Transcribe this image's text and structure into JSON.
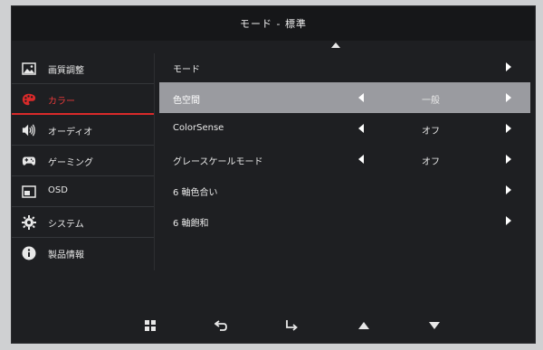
{
  "header": {
    "title": "モード - 標準"
  },
  "sidebar": {
    "items": [
      {
        "label": "画質調整",
        "icon": "picture-icon"
      },
      {
        "label": "カラー",
        "icon": "palette-icon"
      },
      {
        "label": "オーディオ",
        "icon": "speaker-icon"
      },
      {
        "label": "ゲーミング",
        "icon": "gamepad-icon"
      },
      {
        "label": "OSD",
        "icon": "osd-icon"
      },
      {
        "label": "システム",
        "icon": "gear-icon"
      },
      {
        "label": "製品情報",
        "icon": "info-icon"
      }
    ],
    "active_index": 1
  },
  "menu": {
    "rows": [
      {
        "name": "モード",
        "value": ""
      },
      {
        "name": "色空間",
        "value": "一般"
      },
      {
        "name": "ColorSense",
        "value": "オフ"
      },
      {
        "name": "グレースケールモード",
        "value": "オフ"
      },
      {
        "name": "6 軸色合い",
        "value": ""
      },
      {
        "name": "6 軸飽和",
        "value": ""
      }
    ],
    "selected_index": 1
  },
  "bottom_bar": {
    "buttons": [
      "menu-grid-icon",
      "back-icon",
      "enter-icon",
      "up-icon",
      "down-icon"
    ]
  },
  "colors": {
    "accent": "#d92a2a",
    "selected_row": "#9a9ba0",
    "panel": "#1e1f22"
  }
}
